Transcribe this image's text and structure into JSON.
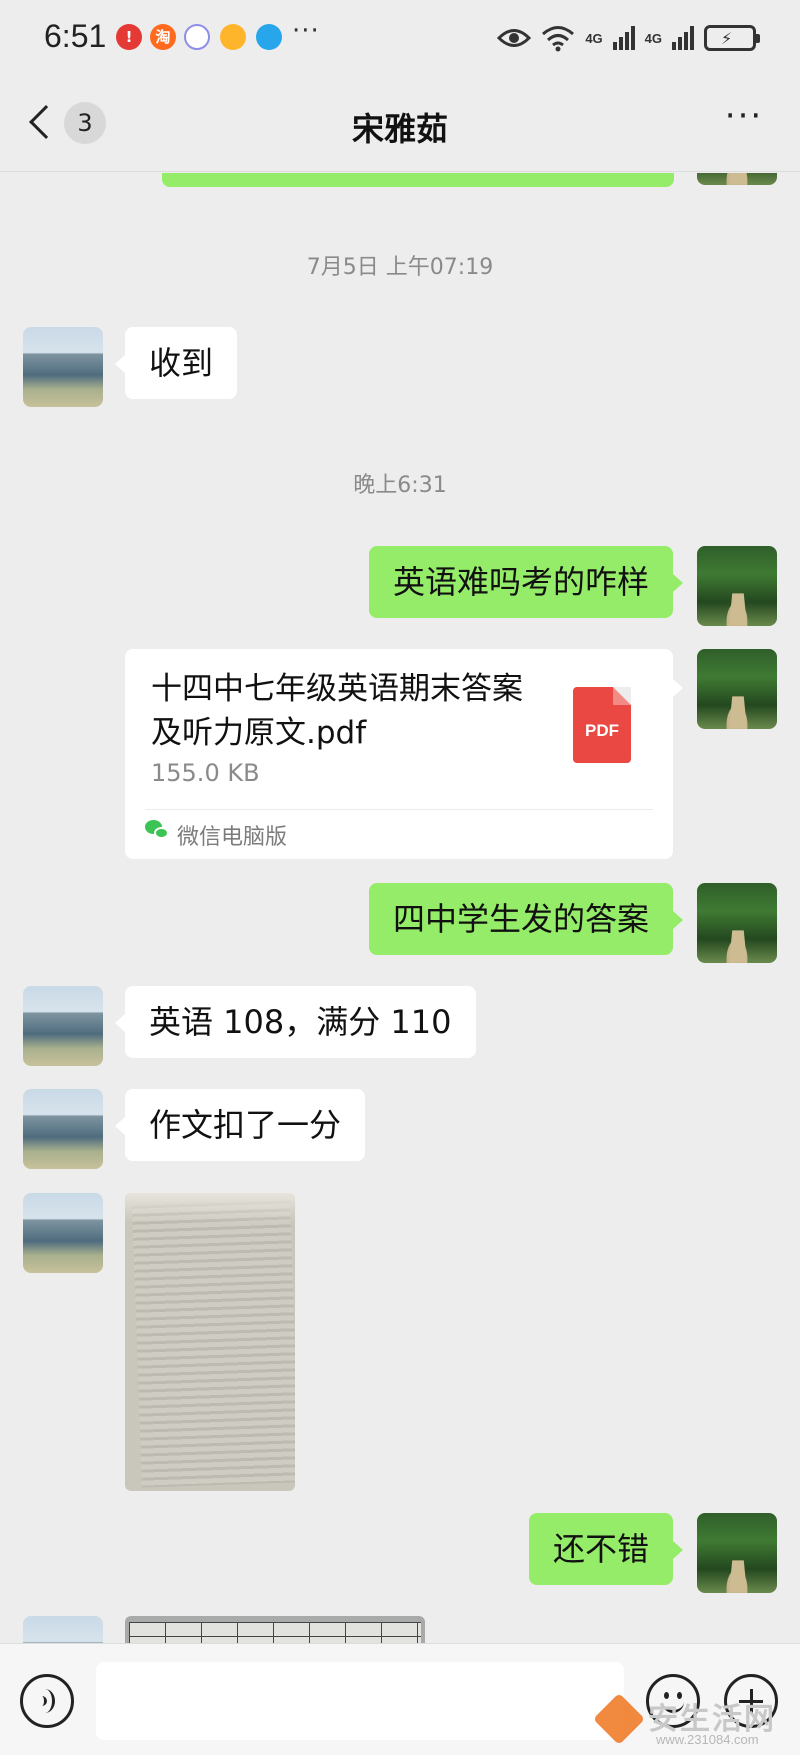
{
  "status_bar": {
    "time": "6:51",
    "notification_icons": [
      "alert-icon",
      "taobao-icon",
      "app-icon",
      "app-icon",
      "cloud-icon"
    ],
    "more": "···",
    "network_1": "4G",
    "network_2": "4G"
  },
  "header": {
    "unread_count": "3",
    "title": "宋雅茹",
    "more": "···"
  },
  "messages": {
    "ts1": "7月5日 上午07:19",
    "m1": "收到",
    "ts2": "晚上6:31",
    "m2": "英语难吗考的咋样",
    "file": {
      "name": "十四中七年级英语期末答案及听力原文.pdf",
      "size": "155.0 KB",
      "type": "PDF",
      "source": "微信电脑版"
    },
    "m3": "四中学生发的答案",
    "m4": "英语 108，满分 110",
    "m5": "作文扣了一分",
    "m6": "还不错"
  },
  "input": {
    "placeholder": ""
  },
  "watermark": {
    "text": "安生活网",
    "url": "www.231084.com"
  },
  "colors": {
    "background": "#ededed",
    "outgoing_bubble": "#95ec69",
    "incoming_bubble": "#ffffff",
    "pdf": "#e94843"
  }
}
